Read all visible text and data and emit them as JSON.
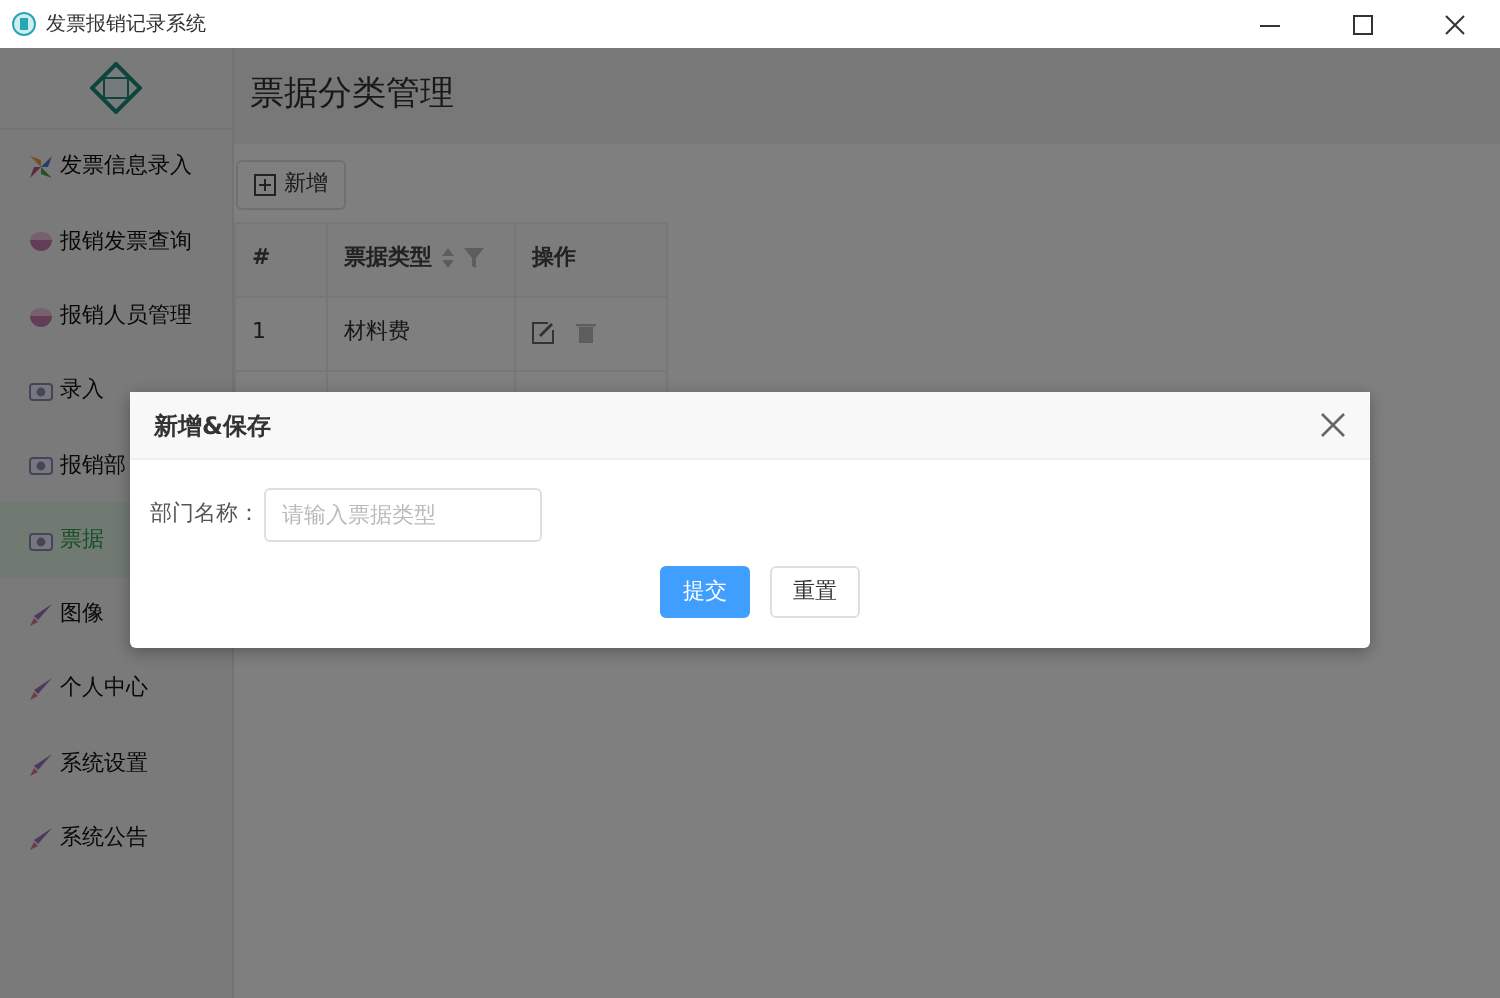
{
  "window": {
    "title": "发票报销记录系统"
  },
  "sidebar": {
    "items": [
      {
        "label": "发票信息录入",
        "kind": "pinwheel",
        "selected": false
      },
      {
        "label": "报销发票查询",
        "kind": "bowl",
        "selected": false
      },
      {
        "label": "报销人员管理",
        "kind": "bowl",
        "selected": false
      },
      {
        "label": "录入",
        "kind": "camera",
        "selected": false
      },
      {
        "label": "报销部",
        "kind": "camera",
        "selected": false
      },
      {
        "label": "票据",
        "kind": "camera",
        "selected": true
      },
      {
        "label": "图像",
        "kind": "brush",
        "selected": false
      },
      {
        "label": "个人中心",
        "kind": "brush",
        "selected": false
      },
      {
        "label": "系统设置",
        "kind": "brush",
        "selected": false
      },
      {
        "label": "系统公告",
        "kind": "brush",
        "selected": false
      }
    ]
  },
  "page": {
    "title": "票据分类管理",
    "add_button": "新增"
  },
  "table": {
    "columns": [
      {
        "label": "#",
        "sortable": false
      },
      {
        "label": "票据类型",
        "sortable": true
      },
      {
        "label": "操作",
        "sortable": false
      }
    ],
    "rows": [
      {
        "index": "1",
        "type": "材料费"
      }
    ]
  },
  "dialog": {
    "title": "新增&保存",
    "field_label": "部门名称：",
    "placeholder": "请输入票据类型",
    "buttons": [
      {
        "label": "提交",
        "kind": "primary"
      },
      {
        "label": "重置",
        "kind": "default"
      }
    ]
  }
}
